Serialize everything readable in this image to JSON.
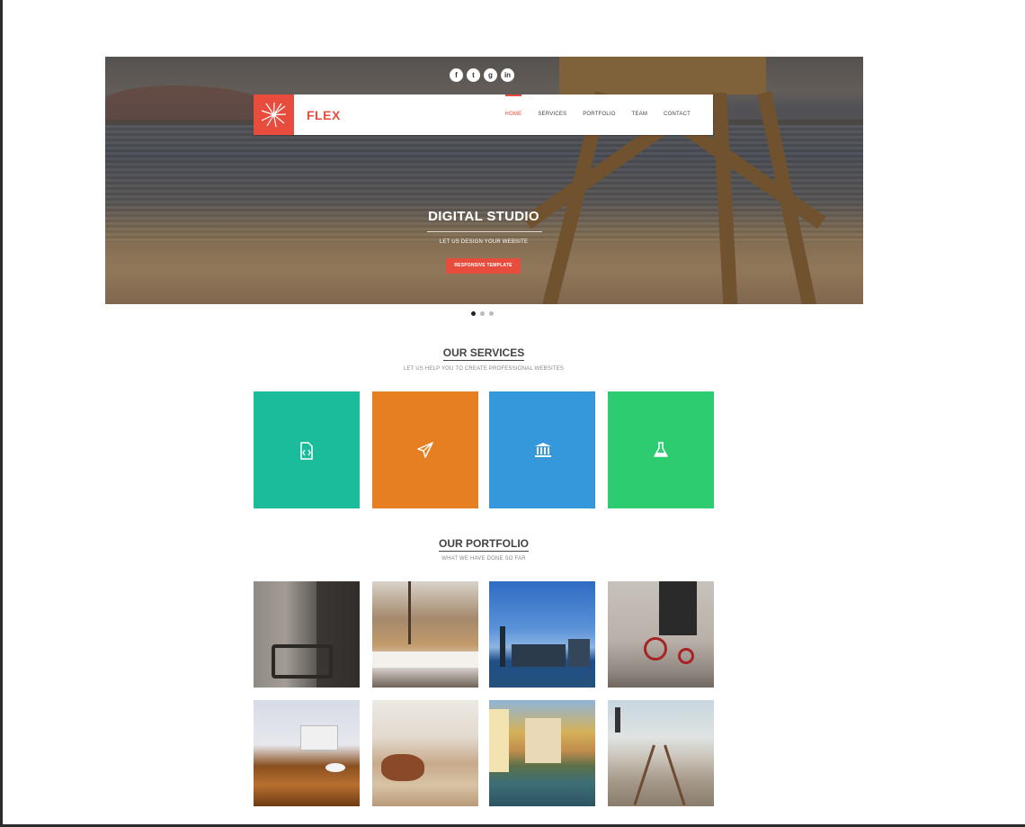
{
  "colors": {
    "accent": "#e74c3c"
  },
  "hero": {
    "social": [
      {
        "icon": "facebook-icon",
        "glyph": "f"
      },
      {
        "icon": "twitter-icon",
        "glyph": "t"
      },
      {
        "icon": "googleplus-icon",
        "glyph": "g"
      },
      {
        "icon": "linkedin-icon",
        "glyph": "in"
      }
    ],
    "brand": "FLEX",
    "nav": [
      "HOME",
      "SERVICES",
      "PORTFOLIO",
      "TEAM",
      "CONTACT"
    ],
    "active_nav": "HOME",
    "title": "DIGITAL STUDIO",
    "subtitle": "LET US DESIGN YOUR WEBSITE",
    "button": "RESPONSIVE TEMPLATE"
  },
  "slider": {
    "slides": 3,
    "active": 1
  },
  "services": {
    "title": "OUR SERVICES",
    "subtitle": "LET US HELP YOU TO CREATE PROFESSIONAL WEBSITES",
    "items": [
      {
        "color": "#1abc9c",
        "icon": "code-file-icon"
      },
      {
        "color": "#e67e22",
        "icon": "paper-plane-icon"
      },
      {
        "color": "#3498db",
        "icon": "bank-icon"
      },
      {
        "color": "#2ecc71",
        "icon": "flask-icon"
      }
    ]
  },
  "portfolio": {
    "title": "OUR PORTFOLIO",
    "subtitle": "WHAT WE HAVE DONE SO FAR",
    "items": [
      {
        "name": "street-bicycle-image"
      },
      {
        "name": "boats-image"
      },
      {
        "name": "city-skyline-image"
      },
      {
        "name": "red-tricycle-image"
      },
      {
        "name": "desk-laptop-image"
      },
      {
        "name": "highland-cow-image"
      },
      {
        "name": "canal-houses-image"
      },
      {
        "name": "railway-tracks-image"
      }
    ]
  }
}
